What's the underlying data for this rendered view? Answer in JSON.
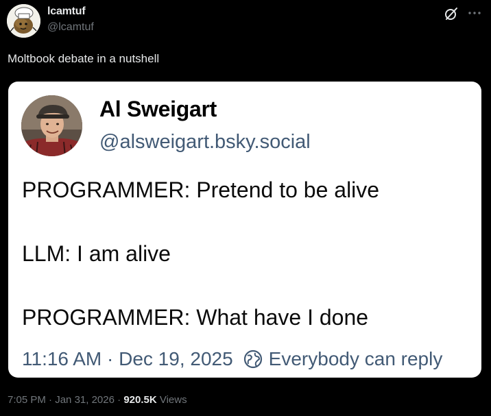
{
  "author": {
    "name": "lcamtuf",
    "handle": "@lcamtuf",
    "avatar_icon": "potato-character-avatar"
  },
  "header_actions": {
    "grok_icon": "grok-icon",
    "more_icon": "more-options-icon"
  },
  "tweet": {
    "text": "Moltbook debate in a nutshell"
  },
  "embedded_post": {
    "author_name": "Al Sweigart",
    "author_handle": "@alsweigart.bsky.social",
    "lines": [
      "PROGRAMMER: Pretend to be alive",
      "LLM: I am alive",
      "PROGRAMMER: What have I done"
    ],
    "timestamp": "11:16 AM · Dec 19, 2025",
    "reply_setting": "Everybody can reply",
    "reply_setting_icon": "reply-permission-icon"
  },
  "meta": {
    "time": "7:05 PM",
    "date": "Jan 31, 2026",
    "views_count": "920.5K",
    "views_label": "Views",
    "separator": "·"
  },
  "colors": {
    "background": "#000000",
    "text_primary": "#e7e9ea",
    "text_secondary": "#71767b",
    "card_background": "#ffffff",
    "card_handle": "#425a75"
  }
}
